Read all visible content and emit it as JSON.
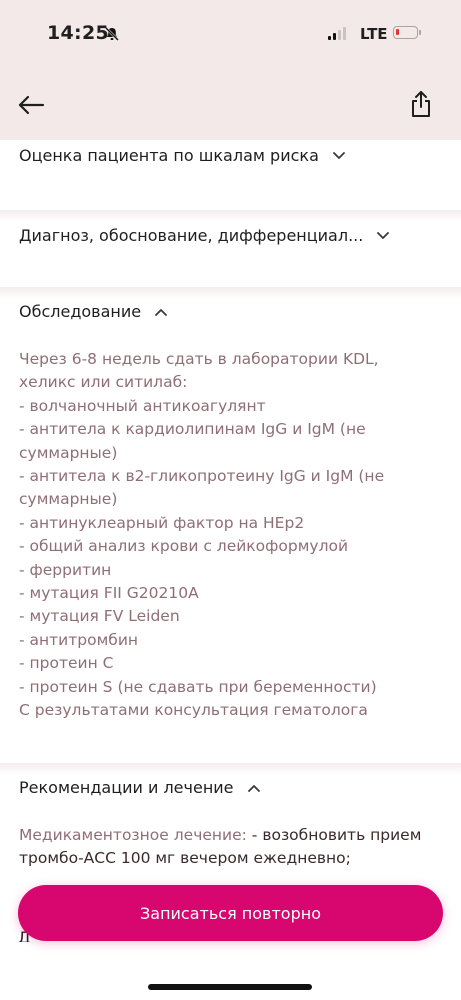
{
  "status_bar": {
    "time": "14:25",
    "network": "LTE",
    "icons": [
      "bell-slash-icon",
      "signal-icon",
      "battery-icon"
    ]
  },
  "nav": {
    "back_icon": "arrow-left-icon",
    "share_icon": "share-icon"
  },
  "sections": {
    "risk": {
      "title": "Оценка пациента по шкалам риска",
      "expanded": false
    },
    "diagnosis": {
      "title": "Диагноз, обоснование, дифференциал...",
      "expanded": false
    },
    "examination": {
      "title": "Обследование",
      "expanded": true,
      "text": "Через 6-8 недель сдать в лаборатории KDL,\nхеликс или ситилаб:\n- волчаночный антикоагулянт\n- антитела к кардиолипинам IgG и IgM (не\nсуммарные)\n- антитела к в2-гликопротеину IgG и IgM (не\nсуммарные)\n- антинуклеарный фактор на HEp2\n- общий анализ крови с лейкоформулой\n- ферритин\n- мутация FII G20210A\n- мутация FV Leiden\n- антитромбин\n- протеин С\n- протеин S (не сдавать при беременности)\nС результатами консультация гематолога"
    },
    "recommendations": {
      "title": "Рекомендации и лечение",
      "expanded": true,
      "label": "Медикаментозное лечение:",
      "text": " - возобновить прием тромбо-АСС 100 мг вечером ежедневно;"
    }
  },
  "cta": {
    "label": "Записаться повторно"
  },
  "peek_text": "Д",
  "colors": {
    "header_bg": "#f4e9e9",
    "accent": "#d8066f",
    "muted_text": "#8f6f76"
  }
}
